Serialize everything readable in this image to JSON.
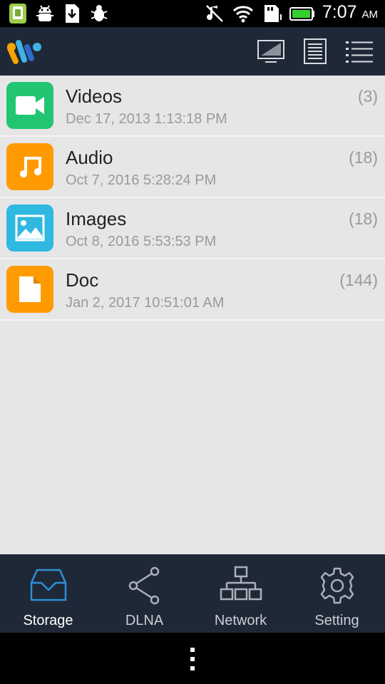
{
  "status_bar": {
    "time": "7:07",
    "ampm": "AM",
    "icons": [
      "app-notification-icon",
      "android-debug-icon",
      "download-file-icon",
      "bug-icon",
      "muted-music-icon",
      "wifi-icon",
      "sd-card-icon",
      "battery-icon"
    ]
  },
  "app_bar": {
    "logo_icon": "app-logo",
    "actions": [
      "screen-icon",
      "document-list-icon",
      "menu-list-icon"
    ]
  },
  "storage_categories": [
    {
      "title": "Videos",
      "date": "Dec 17, 2013 1:13:18 PM",
      "count": "(3)",
      "icon": "video-camera-icon",
      "color": "#22c672"
    },
    {
      "title": "Audio",
      "date": "Oct 7, 2016 5:28:24 PM",
      "count": "(18)",
      "icon": "music-note-icon",
      "color": "#ff9b00"
    },
    {
      "title": "Images",
      "date": "Oct 8, 2016 5:53:53 PM",
      "count": "(18)",
      "icon": "image-icon",
      "color": "#2fb8e0"
    },
    {
      "title": "Doc",
      "date": "Jan 2, 2017 10:51:01 AM",
      "count": "(144)",
      "icon": "document-icon",
      "color": "#ff9b00"
    }
  ],
  "bottom_nav": {
    "items": [
      {
        "label": "Storage",
        "icon": "inbox-tray-icon",
        "active": true
      },
      {
        "label": "DLNA",
        "icon": "share-icon",
        "active": false
      },
      {
        "label": "Network",
        "icon": "network-icon",
        "active": false
      },
      {
        "label": "Setting",
        "icon": "gear-icon",
        "active": false
      }
    ]
  },
  "colors": {
    "app_bar": "#1f2836",
    "content_bg": "#e6e6e6",
    "active_accent": "#2d8fd6",
    "inactive_icon": "#aab0b8"
  }
}
